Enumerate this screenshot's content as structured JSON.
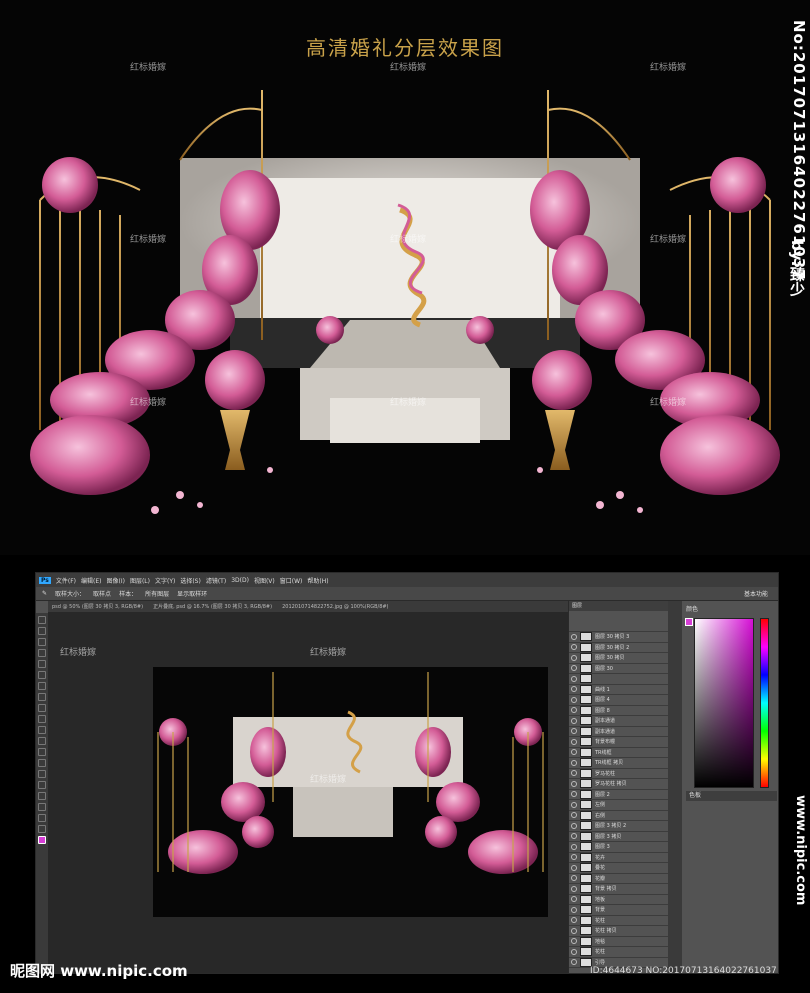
{
  "title": "高清婚礼分层效果图",
  "side_id": "by:臻少 No:20170713164022761037",
  "side_id_author": "by:臻少",
  "side_id_no": "No:20170713164022761037",
  "watermark": "红标婚嫁",
  "ps": {
    "logo": "Ps",
    "menu": [
      "文件(F)",
      "编辑(E)",
      "图像(I)",
      "图层(L)",
      "文字(Y)",
      "选择(S)",
      "滤镜(T)",
      "3D(D)",
      "视图(V)",
      "窗口(W)",
      "帮助(H)"
    ],
    "options": [
      "取样大小：",
      "取样点",
      "样本：",
      "所有图层",
      "显示取样环"
    ],
    "options_right": "基本功能",
    "tabs": [
      "psd @ 50% (图层 30 拷贝 3, RGB/8#)",
      "正片叠底, psd @ 16.7% (图层 30 拷贝 3, RGB/8#)",
      "2012010714822752.jpg @ 100%(RGB/8#)"
    ],
    "layers_title": "图层",
    "layers": [
      "图层 30 拷贝 3",
      "图层 30 拷贝 2",
      "图层 30 拷贝",
      "图层 30",
      "",
      "曲线 1",
      "图层 4",
      "图层 8",
      "副本通道",
      "副本通道",
      "背景布幔",
      "TR线框",
      "TR线框 拷贝",
      "罗马花柱",
      "罗马花柱 拷贝",
      "图层 2",
      "左侧",
      "右侧",
      "图层 3 拷贝 2",
      "图层 3 拷贝",
      "图层 3",
      "花卉",
      "叠花",
      "花瓣",
      "背景 拷贝",
      "地板",
      "背景",
      "花柱",
      "花柱 拷贝",
      "地毯",
      "花柱",
      "引导"
    ],
    "panel_labels": [
      "颜色",
      "色板"
    ]
  },
  "footer": {
    "logo": "昵图网 www.nipic.com",
    "id": "ID:4644673 NO:20170713164022761037",
    "side": "www.nipic.com"
  },
  "colors": {
    "accent": "#c9a24a",
    "pink": "#d66a9f",
    "ps_bg": "#535353"
  }
}
